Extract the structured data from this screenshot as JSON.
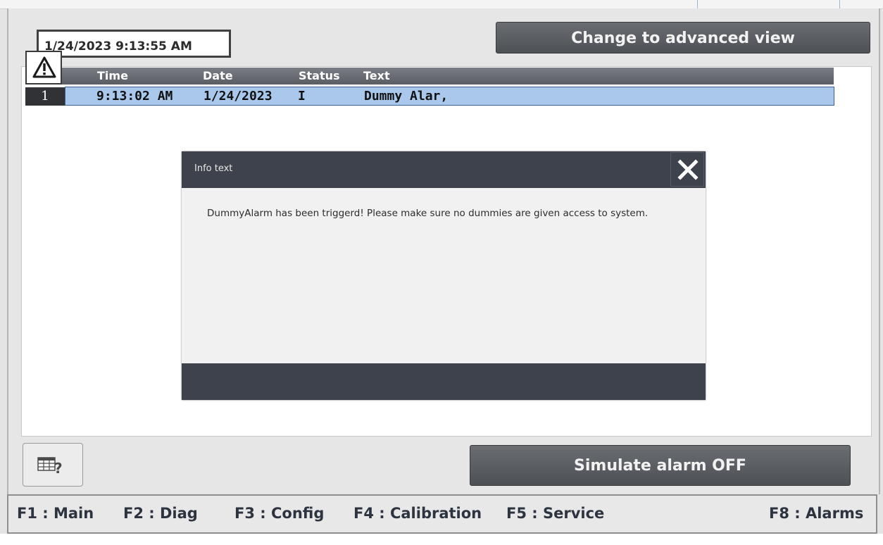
{
  "header": {
    "datetime": "1/24/2023 9:13:55 AM",
    "advanced_view_label": "Change to advanced view"
  },
  "alarm_table": {
    "icon": "warning-triangle-icon",
    "columns": [
      "Time",
      "Date",
      "Status",
      "Text"
    ],
    "rows": [
      {
        "index": "1",
        "time": "9:13:02 AM",
        "date": "1/24/2023",
        "status": "I",
        "text": "Dummy Alar,"
      }
    ],
    "selected_row_color": "#a9c8ec"
  },
  "dialog": {
    "title": "Info text",
    "body": "DummyAlarm has been triggerd! Please make sure no dummies are given access to system.",
    "close_icon": "close-icon"
  },
  "controls": {
    "help_icon": "table-help-icon",
    "simulate_label": "Simulate alarm OFF"
  },
  "function_keys": [
    {
      "label": "F1 : Main"
    },
    {
      "label": "F2 : Diag"
    },
    {
      "label": "F3 : Config"
    },
    {
      "label": "F4 : Calibration"
    },
    {
      "label": "F5 : Service"
    },
    {
      "label": "F8 : Alarms"
    }
  ],
  "colors": {
    "button_dark": "#55595e",
    "dialog_bar": "#3e424c",
    "function_key_text": "#2d3440"
  }
}
